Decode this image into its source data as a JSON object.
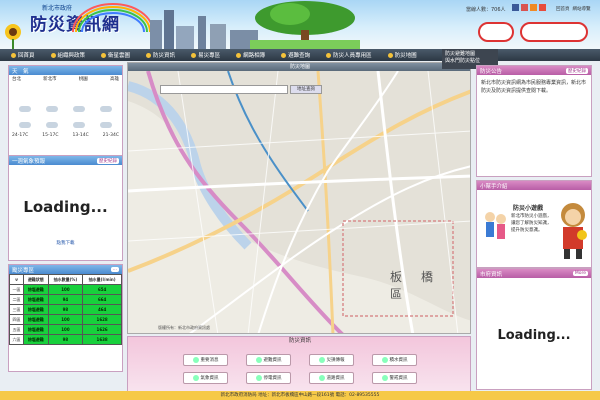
{
  "header": {
    "agency": "新北市政府",
    "logo": "防災資訊網",
    "visitors": "當線人數：706人",
    "links": [
      "回首頁",
      "網站導覽"
    ]
  },
  "nav": [
    "回首頁",
    "組織與政策",
    "衛星雲圖",
    "防災資訊",
    "易災專區",
    "網路相簿",
    "避難查詢",
    "防災人員專用區",
    "防災地圖"
  ],
  "map_dropdown": [
    "防災避難地圖",
    "與水門防災點位"
  ],
  "weather": {
    "title": "天　氣",
    "header": [
      "台北",
      "新北市",
      "桃園",
      "高雄"
    ],
    "temps": [
      "24-17C",
      "15-17C",
      "13-14C",
      "21-34C"
    ]
  },
  "rain": {
    "title": "一週氣象預報",
    "more": "歷史紀錄",
    "loading": "Loading...",
    "link": "點我下載"
  },
  "status": {
    "title": "颱災專區",
    "cols": [
      "避難狀態",
      "抽水數量(%)",
      "抽水量(l/min)"
    ],
    "rows": [
      [
        "一區",
        "除塩避難",
        "100",
        "654"
      ],
      [
        "二區",
        "除塩避難",
        "94",
        "664"
      ],
      [
        "三區",
        "除塩避難",
        "98",
        "464"
      ],
      [
        "四區",
        "除塩避難",
        "100",
        "1628"
      ],
      [
        "五區",
        "除塩避難",
        "100",
        "1626"
      ],
      [
        "六區",
        "除塩避難",
        "98",
        "1638"
      ]
    ]
  },
  "map": {
    "title": "防災地圖",
    "search_btn": "地址查詢",
    "area_label": "板橋區",
    "copyright": "版權所有：新北市政府資訊處"
  },
  "disaster": {
    "title": "防災資訊",
    "buttons": [
      "重要消息",
      "避難資訊",
      "災損傳報",
      "積水資訊",
      "氣象資訊",
      "停電資訊",
      "道路資訊",
      "警戒資訊"
    ]
  },
  "notice": {
    "title": "防災公告",
    "more": "歷史紀錄",
    "text": "新北市防災資訊網為市民服務專業資訊，新北市防災及防災資訊提供查閱下載。"
  },
  "mascot": {
    "title": "小幫手介紹",
    "name": "防災小遊戲",
    "desc": "新北市防災小遊戲，讓您了解防災知識，提升防災意識。"
  },
  "cloudpanel": {
    "title": "市府資訊",
    "more": "More",
    "loading": "Loading..."
  },
  "footer": "新北市政府消防局 地址：新北市板橋區中山路一段161號 電話：02-89535555"
}
